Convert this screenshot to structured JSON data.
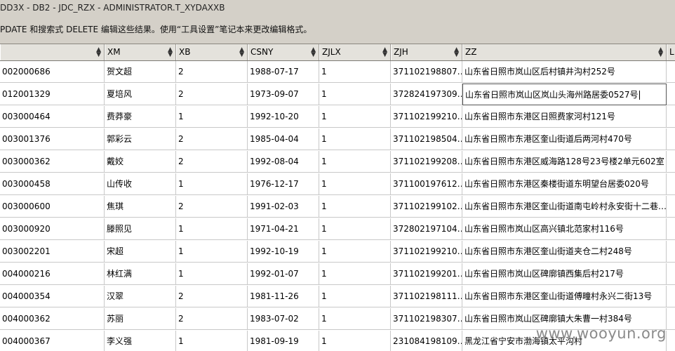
{
  "window": {
    "title": "DD3X - DB2 - JDC_RZX - ADMINISTRATOR.T_XYDAXXB"
  },
  "infobar": {
    "text": "PDATE 和搜索式 DELETE 编辑这些结果。使用“工具设置”笔记本来更改编辑格式。"
  },
  "table": {
    "columns": [
      "",
      "XM",
      "XB",
      "CSNY",
      "ZJLX",
      "ZJH",
      "ZZ",
      "L"
    ],
    "rows": [
      [
        "002000686",
        "贺文超",
        "2",
        "1988-07-17",
        "1",
        "371102198807…",
        "山东省日照市岚山区后村镇井沟村252号"
      ],
      [
        "012001329",
        "夏培风",
        "2",
        "1973-09-07",
        "1",
        "372824197309…",
        "山东省日照市岚山区岚山头海州路居委0527号"
      ],
      [
        "003000464",
        "费莽豪",
        "1",
        "1992-10-20",
        "1",
        "371102199210…",
        "山东省日照市东港区日照费家河村121号"
      ],
      [
        "003001376",
        "郭彩云",
        "2",
        "1985-04-04",
        "1",
        "371102198504…",
        "山东省日照市东港区奎山街道后两河村470号"
      ],
      [
        "003000362",
        "戴姣",
        "2",
        "1992-08-04",
        "1",
        "371102199208…",
        "山东省日照市东港区威海路128号23号楼2单元602室"
      ],
      [
        "003000458",
        "山传收",
        "1",
        "1976-12-17",
        "1",
        "371100197612…",
        "山东省日照市东港区秦楼街道东明望台居委020号"
      ],
      [
        "003000600",
        "焦琪",
        "2",
        "1991-02-03",
        "1",
        "371102199102…",
        "山东省日照市东港区奎山街道南屯岭村永安街十二巷…"
      ],
      [
        "003000920",
        "滕照见",
        "1",
        "1971-04-21",
        "1",
        "372802197104…",
        "山东省日照市岚山区高兴镇北范家村116号"
      ],
      [
        "003002201",
        "宋超",
        "1",
        "1992-10-19",
        "1",
        "371102199210…",
        "山东省日照市东港区奎山街道夹仓二村248号"
      ],
      [
        "004000216",
        "林红满",
        "1",
        "1992-01-07",
        "1",
        "371102199201…",
        "山东省日照市岚山区碑廓镇西集后村217号"
      ],
      [
        "004000354",
        "汉翠",
        "2",
        "1981-11-26",
        "1",
        "371102198111…",
        "山东省日照市东港区奎山街道傅疃村永兴二街13号"
      ],
      [
        "004000362",
        "苏丽",
        "2",
        "1983-07-02",
        "1",
        "371102198307…",
        "山东省日照市岚山区碑廓镇大朱曹一村384号"
      ],
      [
        "004000367",
        "李义强",
        "1",
        "1981-09-19",
        "1",
        "231084198109…",
        "黑龙江省宁安市渤海镇太平沟村"
      ]
    ]
  },
  "watermark": "www.wooyun.org"
}
